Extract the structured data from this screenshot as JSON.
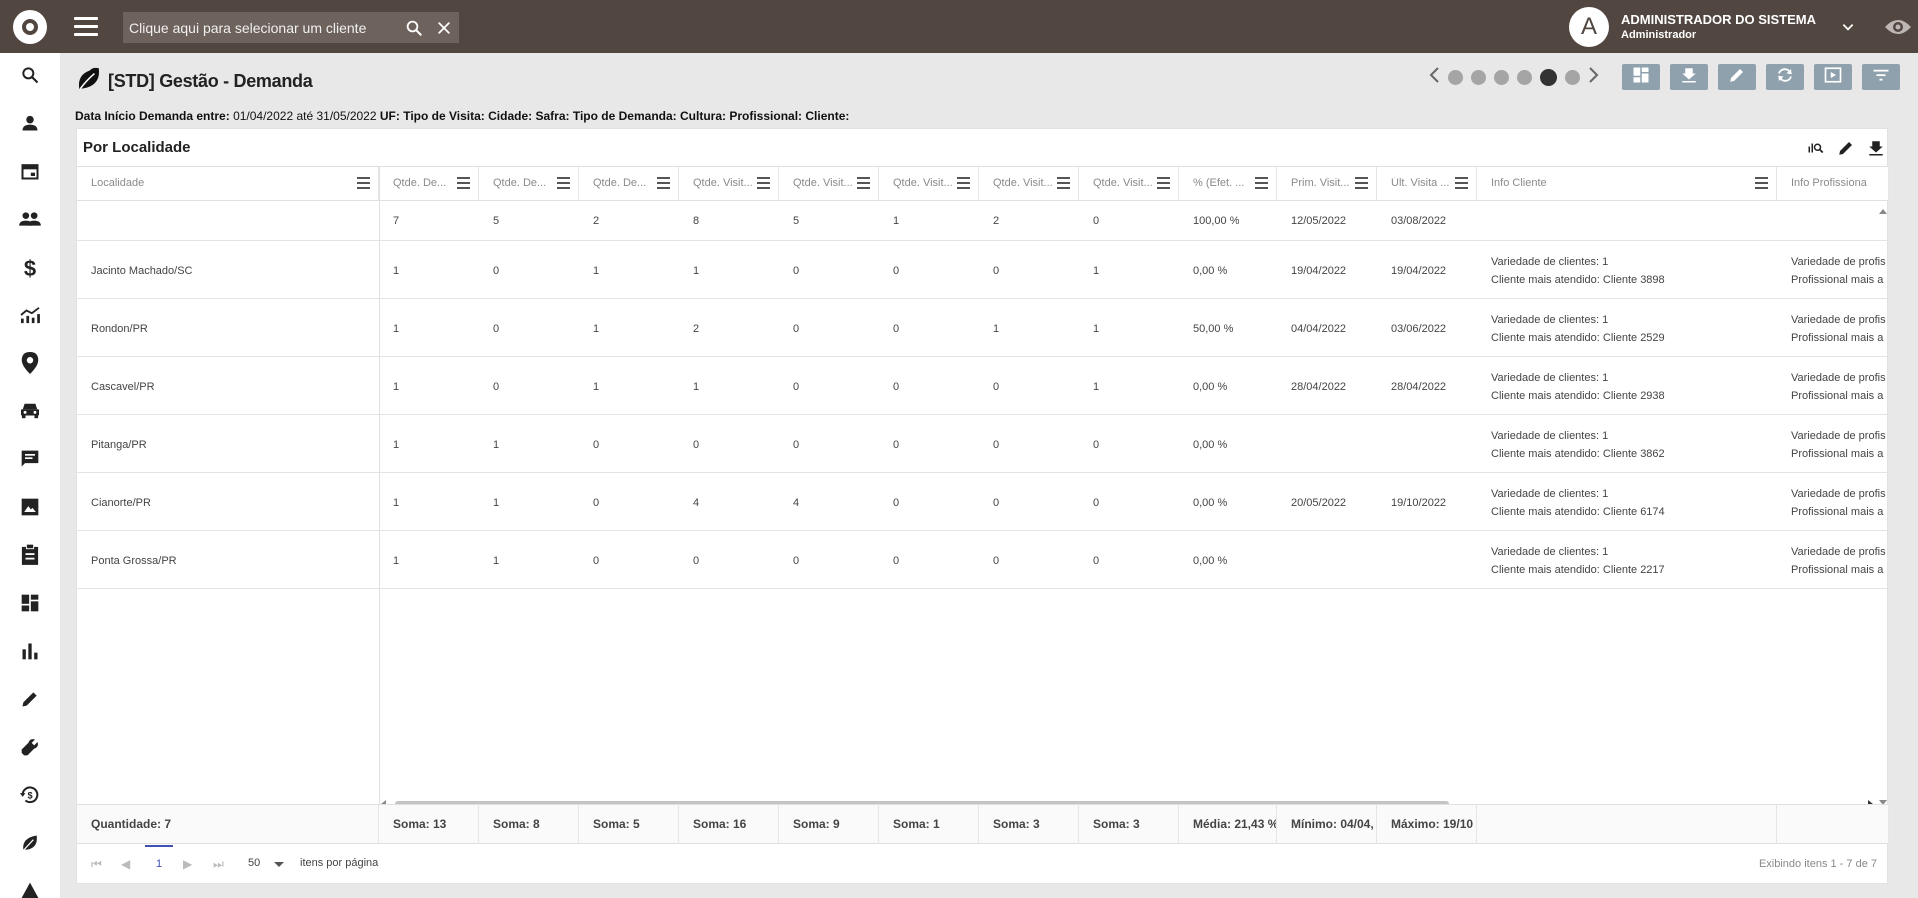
{
  "topbar": {
    "search_placeholder": "Clique aqui para selecionar um cliente",
    "avatar_letter": "A",
    "user_name": "ADMINISTRADOR DO SISTEMA",
    "user_role": "Administrador"
  },
  "sidebar": {
    "items": [
      "search-icon",
      "person-icon",
      "calendar-icon",
      "people-icon",
      "dollar-icon",
      "trending-icon",
      "location-icon",
      "car-icon",
      "chat-icon",
      "image-icon",
      "clipboard-icon",
      "dashboard-icon",
      "bar-chart-icon",
      "pencil-icon",
      "wrench-icon",
      "history-dollar-icon",
      "leaf-icon",
      "warning-icon"
    ]
  },
  "page": {
    "title": "[STD] Gestão - Demanda",
    "pager_total": 6,
    "pager_active": 5
  },
  "filters": {
    "data_label": "Data Início Demanda entre:",
    "data_value": "01/04/2022 até 31/05/2022",
    "uf": "UF:",
    "tipo_visita": "Tipo de Visita:",
    "cidade": "Cidade:",
    "safra": "Safra:",
    "tipo_demanda": "Tipo de Demanda:",
    "cultura": "Cultura:",
    "profissional": "Profissional:",
    "cliente": "Cliente:"
  },
  "panel": {
    "title": "Por Localidade",
    "columns": [
      "Localidade",
      "Qtde. De...",
      "Qtde. De...",
      "Qtde. De...",
      "Qtde. Visit...",
      "Qtde. Visit...",
      "Qtde. Visit...",
      "Qtde. Visit...",
      "Qtde. Visit...",
      "% (Efet. ...",
      "Prim. Visit...",
      "Últ. Visita ...",
      "Info Cliente",
      "Info Profissional"
    ],
    "totals_row": [
      "",
      "7",
      "5",
      "2",
      "8",
      "5",
      "1",
      "2",
      "0",
      "100,00 %",
      "12/05/2022",
      "03/08/2022",
      "",
      ""
    ],
    "rows": [
      {
        "loc": "Jacinto Machado/SC",
        "vals": [
          "1",
          "0",
          "1",
          "1",
          "0",
          "0",
          "0",
          "1",
          "0,00 %",
          "19/04/2022",
          "19/04/2022"
        ],
        "cli1": "Variedade de clientes: 1",
        "cli2": "Cliente mais atendido: Cliente 3898",
        "prof1": "Variedade de profis",
        "prof2": "Profissional mais a"
      },
      {
        "loc": "Rondon/PR",
        "vals": [
          "1",
          "0",
          "1",
          "2",
          "0",
          "0",
          "1",
          "1",
          "50,00 %",
          "04/04/2022",
          "03/06/2022"
        ],
        "cli1": "Variedade de clientes: 1",
        "cli2": "Cliente mais atendido: Cliente 2529",
        "prof1": "Variedade de profis",
        "prof2": "Profissional mais a"
      },
      {
        "loc": "Cascavel/PR",
        "vals": [
          "1",
          "0",
          "1",
          "1",
          "0",
          "0",
          "0",
          "1",
          "0,00 %",
          "28/04/2022",
          "28/04/2022"
        ],
        "cli1": "Variedade de clientes: 1",
        "cli2": "Cliente mais atendido: Cliente 2938",
        "prof1": "Variedade de profis",
        "prof2": "Profissional mais a"
      },
      {
        "loc": "Pitanga/PR",
        "vals": [
          "1",
          "1",
          "0",
          "0",
          "0",
          "0",
          "0",
          "0",
          "0,00 %",
          "",
          ""
        ],
        "cli1": "Variedade de clientes: 1",
        "cli2": "Cliente mais atendido: Cliente 3862",
        "prof1": "Variedade de profis",
        "prof2": "Profissional mais a"
      },
      {
        "loc": "Cianorte/PR",
        "vals": [
          "1",
          "1",
          "0",
          "4",
          "4",
          "0",
          "0",
          "0",
          "0,00 %",
          "20/05/2022",
          "19/10/2022"
        ],
        "cli1": "Variedade de clientes: 1",
        "cli2": "Cliente mais atendido: Cliente 6174",
        "prof1": "Variedade de profis",
        "prof2": "Profissional mais a"
      },
      {
        "loc": "Ponta Grossa/PR",
        "vals": [
          "1",
          "1",
          "0",
          "0",
          "0",
          "0",
          "0",
          "0",
          "0,00 %",
          "",
          ""
        ],
        "cli1": "Variedade de clientes: 1",
        "cli2": "Cliente mais atendido: Cliente 2217",
        "prof1": "Variedade de profis",
        "prof2": "Profissional mais a"
      }
    ],
    "footer": [
      "Quantidade: 7",
      "Soma: 13",
      "Soma: 8",
      "Soma: 5",
      "Soma: 16",
      "Soma: 9",
      "Soma: 1",
      "Soma: 3",
      "Soma: 3",
      "Média: 21,43 %",
      "Mínimo: 04/04,",
      "Máximo: 19/10",
      "",
      ""
    ],
    "pagination": {
      "current_page": "1",
      "per_page": "50",
      "per_page_label": "itens por página",
      "range": "Exibindo itens 1 - 7 de 7"
    }
  }
}
